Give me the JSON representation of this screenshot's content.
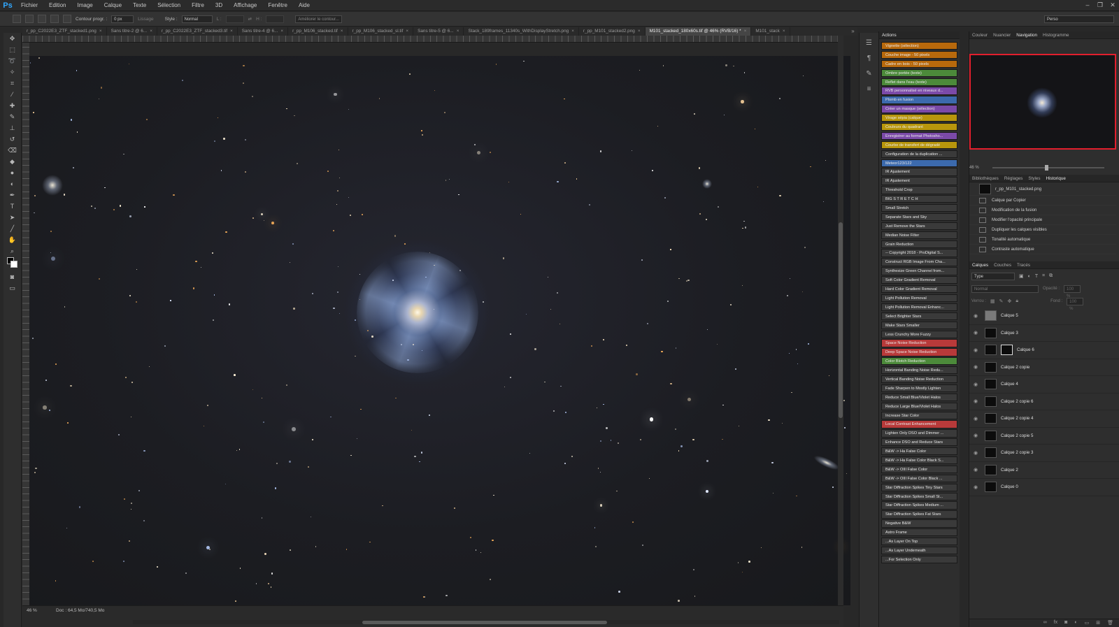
{
  "app": {
    "logo": "Ps"
  },
  "menubar": {
    "items": [
      "Fichier",
      "Edition",
      "Image",
      "Calque",
      "Texte",
      "Sélection",
      "Filtre",
      "3D",
      "Affichage",
      "Fenêtre",
      "Aide"
    ]
  },
  "window_controls": [
    "–",
    "❐",
    "✕"
  ],
  "options_bar": {
    "contour_label": "Contour progr. :",
    "contour_value": "0 px",
    "lissage_label": "Lissage",
    "style_label": "Style :",
    "style_value": "Normal",
    "l_label": "L :",
    "h_label": "H :",
    "ameliorer_label": "Améliorer le contour...",
    "workspace_value": "Perso"
  },
  "tabs": [
    {
      "label": "r_pp_C2022E3_ZTF_stacked1.png",
      "active": false
    },
    {
      "label": "Sans titre-2 @ 6...",
      "active": false
    },
    {
      "label": "r_pp_C2022E3_ZTF_stacked3.tif",
      "active": false
    },
    {
      "label": "Sans titre-4 @ 6...",
      "active": false
    },
    {
      "label": "r_pp_M106_stacked.tif",
      "active": false
    },
    {
      "label": "r_pp_M106_stacked_sl.tif",
      "active": false
    },
    {
      "label": "Sans titre-5 @ 6...",
      "active": false
    },
    {
      "label": "Stack_189frames_11340s_WithDisplayStretch.png",
      "active": false
    },
    {
      "label": "r_pp_M101_stacked2.png",
      "active": false
    },
    {
      "label": "M101_stacked_180x60s.tif @ 46% (RVB/16) *",
      "active": true
    },
    {
      "label": "M101_stack",
      "active": false
    }
  ],
  "actions_panel": {
    "title": "Actions",
    "items": [
      {
        "label": "Vignette (sélection)",
        "color": "#b8690c"
      },
      {
        "label": "Couche image - 50 pixels",
        "color": "#b8690c"
      },
      {
        "label": "Cadre en bois - 50 pixels",
        "color": "#b8690c"
      },
      {
        "label": "Ombre portée (texte)",
        "color": "#4c8a3a"
      },
      {
        "label": "Reflet dans l'eau (texte)",
        "color": "#4c8a3a"
      },
      {
        "label": "RVB personnalisé en niveaux d...",
        "color": "#7b4aa8"
      },
      {
        "label": "Plomb en fusion",
        "color": "#3c6aad"
      },
      {
        "label": "Créer un masque (sélection)",
        "color": "#7b4aa8"
      },
      {
        "label": "Virage sépia (calque)",
        "color": "#b8960c"
      },
      {
        "label": "Couleurs du quadrant",
        "color": "#b8960c"
      },
      {
        "label": "Enregistrer au format Photosho...",
        "color": "#7b4aa8"
      },
      {
        "label": "Courbe de transfert de dégradé",
        "color": "#b8960c"
      },
      {
        "label": "Configuration de la duplication ...",
        "color": "#3a3a3a"
      },
      {
        "label": "Meteor123/122",
        "color": "#3c6aad"
      },
      {
        "label": "IR Ajustement",
        "color": "#3a3a3a"
      },
      {
        "label": "IR Ajustement",
        "color": "#3a3a3a"
      },
      {
        "label": "Threshold Crop",
        "color": "#3a3a3a"
      },
      {
        "label": "BIG S T R E T C H",
        "color": "#3a3a3a"
      },
      {
        "label": "Small Stretch",
        "color": "#3a3a3a"
      },
      {
        "label": "Separate Stars and Sky",
        "color": "#3a3a3a"
      },
      {
        "label": "Just Remove the Stars",
        "color": "#3a3a3a"
      },
      {
        "label": "Median Noise Filter",
        "color": "#3a3a3a"
      },
      {
        "label": "Grain Reduction",
        "color": "#3a3a3a"
      },
      {
        "label": "-- Copyright 2018 - ProDigital S...",
        "color": "#3a3a3a"
      },
      {
        "label": "Construct RGB Image From Cha...",
        "color": "#3a3a3a"
      },
      {
        "label": "Synthesize Green Channel from...",
        "color": "#3a3a3a"
      },
      {
        "label": "Soft Color Gradient Removal",
        "color": "#3a3a3a"
      },
      {
        "label": "Hard Color Gradient Removal",
        "color": "#3a3a3a"
      },
      {
        "label": "Light Pollution Removal",
        "color": "#3a3a3a"
      },
      {
        "label": "Light Pollution Removal Enhanc...",
        "color": "#3a3a3a"
      },
      {
        "label": "Select Brighter Stars",
        "color": "#3a3a3a"
      },
      {
        "label": "Make Stars Smaller",
        "color": "#3a3a3a"
      },
      {
        "label": "Less Crunchy More Fuzzy",
        "color": "#3a3a3a"
      },
      {
        "label": "Space Noise Reduction",
        "color": "#b83a3a"
      },
      {
        "label": "Deep Space Noise Reduction",
        "color": "#b83a3a"
      },
      {
        "label": "Color Blotch Reduction",
        "color": "#4c8a3a"
      },
      {
        "label": "Horizontal Banding Noise Redu...",
        "color": "#3a3a3a"
      },
      {
        "label": "Vertical Banding Noise Reduction",
        "color": "#3a3a3a"
      },
      {
        "label": "Fade Sharpen to Mostly Lighten",
        "color": "#3a3a3a"
      },
      {
        "label": "Reduce Small Blue/Violet Halos",
        "color": "#3a3a3a"
      },
      {
        "label": "Reduce Large Blue/Violet Halos",
        "color": "#3a3a3a"
      },
      {
        "label": "Increase Star Color",
        "color": "#3a3a3a"
      },
      {
        "label": "Local Contrast Enhancement",
        "color": "#b83a3a"
      },
      {
        "label": "Lighten Only DSO and Dimmer ...",
        "color": "#3a3a3a"
      },
      {
        "label": "Enhance DSO and Reduce Stars",
        "color": "#3a3a3a"
      },
      {
        "label": "B&W -> Ha False Color",
        "color": "#3a3a3a"
      },
      {
        "label": "B&W -> Ha False Color Black S...",
        "color": "#3a3a3a"
      },
      {
        "label": "B&W -> OIII False Color",
        "color": "#3a3a3a"
      },
      {
        "label": "B&W -> OIII False Color Black ...",
        "color": "#3a3a3a"
      },
      {
        "label": "Star Diffraction Spikes Tiny Stars",
        "color": "#3a3a3a"
      },
      {
        "label": "Star Diffraction Spikes Small St...",
        "color": "#3a3a3a"
      },
      {
        "label": "Star Diffraction Spikes Medium ...",
        "color": "#3a3a3a"
      },
      {
        "label": "Star Diffraction Spikes Fat Stars",
        "color": "#3a3a3a"
      },
      {
        "label": "Negative B&W",
        "color": "#3a3a3a"
      },
      {
        "label": "Astro Frame",
        "color": "#3a3a3a"
      },
      {
        "label": "...As Layer On Top",
        "color": "#3a3a3a"
      },
      {
        "label": "...As Layer Underneath",
        "color": "#3a3a3a"
      },
      {
        "label": "...For Selection Only",
        "color": "#3a3a3a"
      }
    ]
  },
  "top_right_tabs": [
    {
      "label": "Couleur",
      "active": false
    },
    {
      "label": "Nuancier",
      "active": false
    },
    {
      "label": "Navigation",
      "active": true
    },
    {
      "label": "Histogramme",
      "active": false
    }
  ],
  "navigator": {
    "zoom": "46 %"
  },
  "middle_tabs": [
    {
      "label": "Bibliothèques",
      "active": false
    },
    {
      "label": "Réglages",
      "active": false
    },
    {
      "label": "Styles",
      "active": false
    },
    {
      "label": "Historique",
      "active": true
    }
  ],
  "history": {
    "snapshot": "r_pp_M101_stacked.png",
    "items": [
      "Calque par Copier",
      "Modification de la fusion",
      "Modifier l'opacité principale",
      "Dupliquer les calques visibles",
      "Tonalité automatique",
      "Contraste automatique"
    ]
  },
  "layers_tabs": [
    {
      "label": "Calques",
      "active": true
    },
    {
      "label": "Couches",
      "active": false
    },
    {
      "label": "Tracés",
      "active": false
    }
  ],
  "layers_panel": {
    "filter_value": "Type",
    "blend_value": "Normal",
    "opacity_label": "Opacité :",
    "opacity_value": "100 %",
    "lock_label": "Verrou :",
    "fill_label": "Fond :",
    "fill_value": "100 %",
    "layers": [
      {
        "name": "Calque 5",
        "thumb": "grey",
        "mask": false
      },
      {
        "name": "Calque 3",
        "thumb": "dark",
        "mask": false
      },
      {
        "name": "Calque 6",
        "thumb": "dark",
        "mask": true
      },
      {
        "name": "Calque 2 copie",
        "thumb": "dark",
        "mask": false
      },
      {
        "name": "Calque 4",
        "thumb": "dark",
        "mask": false
      },
      {
        "name": "Calque 2 copie 6",
        "thumb": "dark",
        "mask": false
      },
      {
        "name": "Calque 2 copie 4",
        "thumb": "dark",
        "mask": false
      },
      {
        "name": "Calque 2 copie 5",
        "thumb": "dark",
        "mask": false
      },
      {
        "name": "Calque 2 copie 3",
        "thumb": "dark",
        "mask": false
      },
      {
        "name": "Calque 2",
        "thumb": "dark",
        "mask": false
      },
      {
        "name": "Calque 0",
        "thumb": "dark",
        "mask": false
      }
    ]
  },
  "status": {
    "zoom": "46 %",
    "doc": "Doc : 64,5 Mo/740,5 Mo"
  }
}
